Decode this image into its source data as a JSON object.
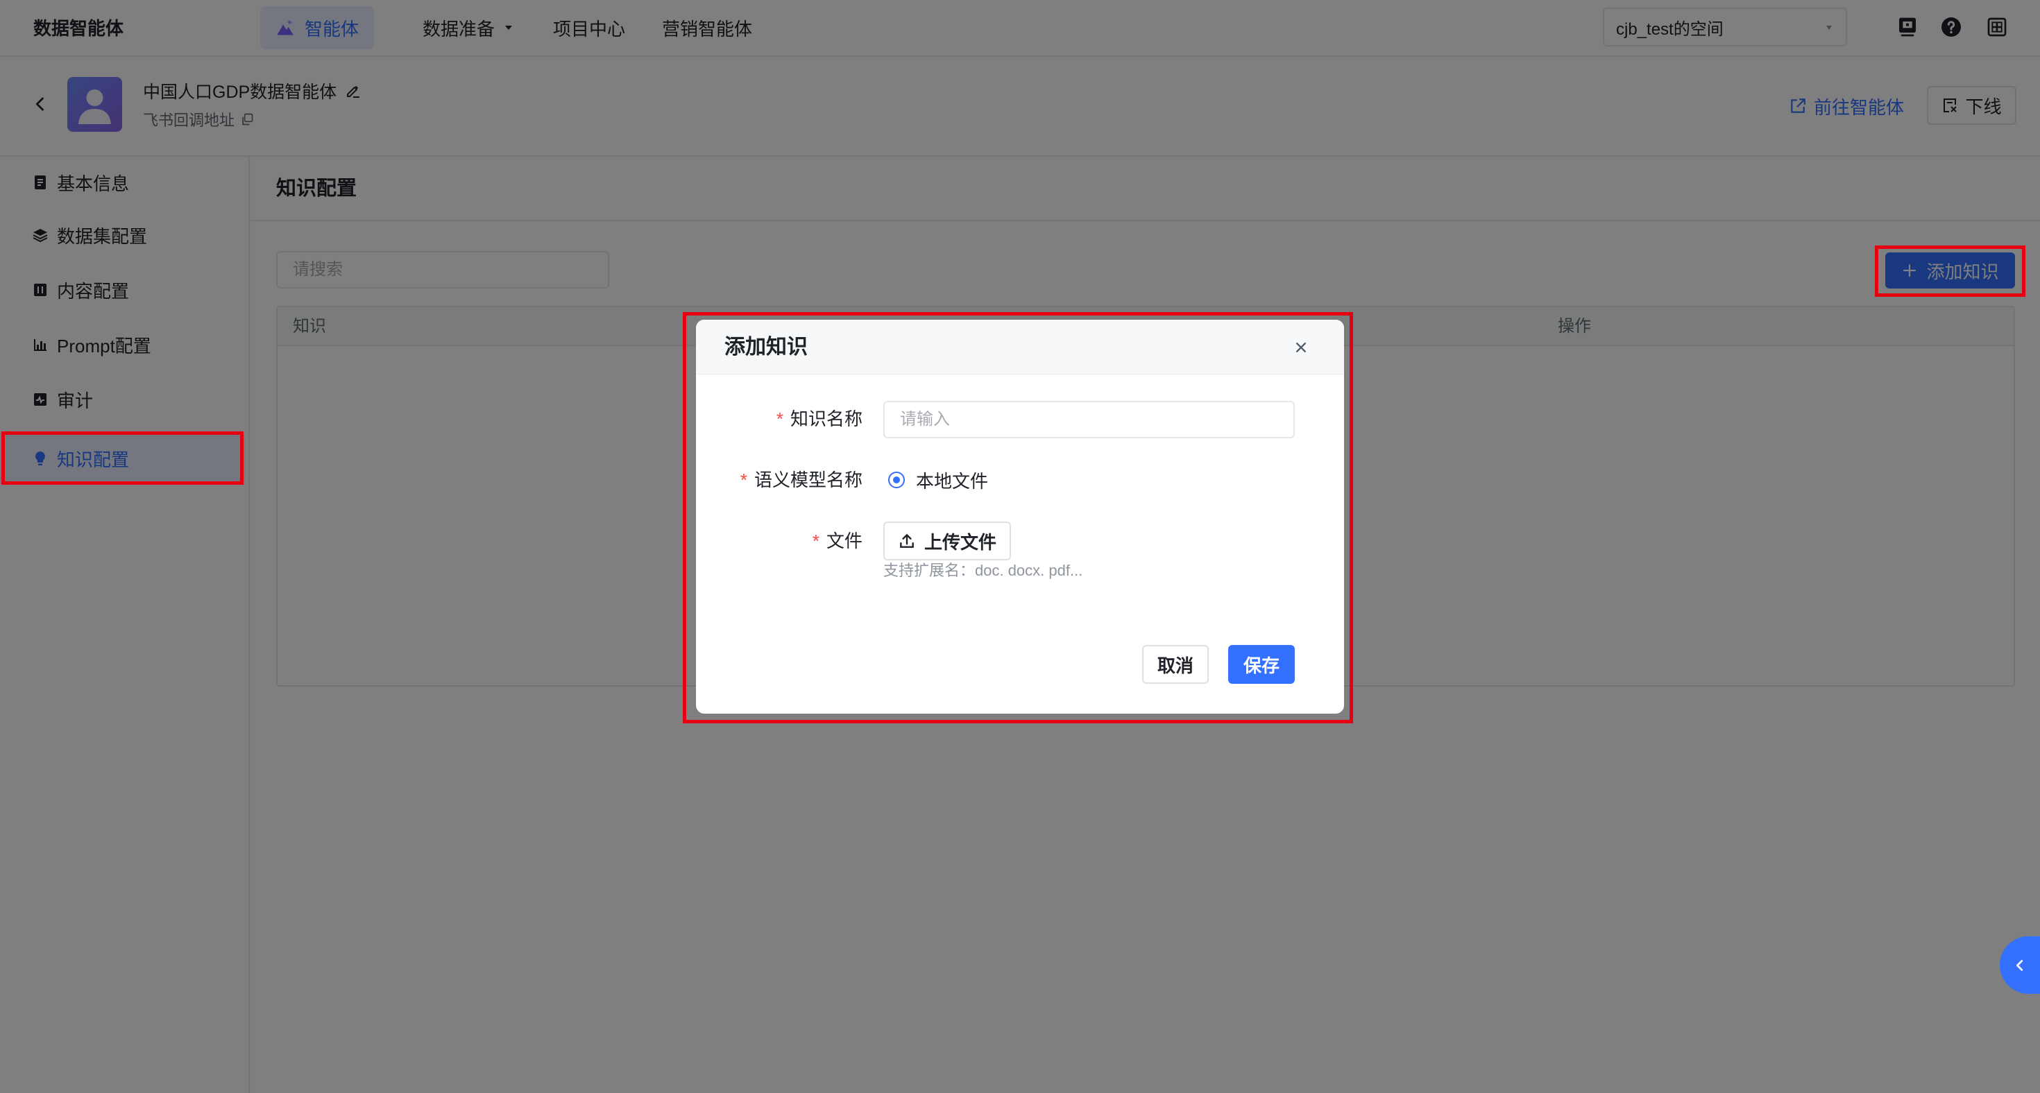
{
  "topnav": {
    "brand": "数据智能体",
    "items": [
      {
        "label": "智能体",
        "icon": "agent-icon",
        "active": true
      },
      {
        "label": "数据准备",
        "has_dropdown": true
      },
      {
        "label": "项目中心"
      },
      {
        "label": "营销智能体"
      }
    ],
    "workspace": {
      "selected": "cjb_test的空间"
    },
    "actions": [
      {
        "icon": "monitor-icon"
      },
      {
        "icon": "help-icon"
      },
      {
        "icon": "grid-icon"
      }
    ]
  },
  "agent_header": {
    "title": "中国人口GDP数据智能体",
    "subtitle": "飞书回调地址",
    "goto_label": "前往智能体",
    "offline_label": "下线"
  },
  "sidebar": {
    "items": [
      {
        "label": "基本信息",
        "icon": "file-icon"
      },
      {
        "label": "数据集配置",
        "icon": "layers-icon"
      },
      {
        "label": "内容配置",
        "icon": "table-icon"
      },
      {
        "label": "Prompt配置",
        "icon": "bar-chart-icon"
      },
      {
        "label": "审计",
        "icon": "activity-icon"
      },
      {
        "label": "知识配置",
        "icon": "bulb-icon",
        "active": true
      }
    ]
  },
  "main": {
    "title": "知识配置",
    "search": {
      "placeholder": "请搜索"
    },
    "add_button_label": "添加知识",
    "table": {
      "columns": [
        "知识",
        "操作"
      ],
      "rows": []
    }
  },
  "modal": {
    "title": "添加知识",
    "required_mark": "*",
    "fields": {
      "name": {
        "label": "知识名称",
        "placeholder": "请输入"
      },
      "model": {
        "label": "语义模型名称",
        "options": [
          "本地文件"
        ],
        "selected_index": 0
      },
      "file": {
        "label": "文件",
        "upload_label": "上传文件",
        "hint": "支持扩展名：doc. docx. pdf..."
      }
    },
    "cancel_label": "取消",
    "save_label": "保存"
  },
  "colors": {
    "primary": "#3370ff",
    "active_bg": "#e8efff",
    "required": "#f54a45",
    "annotation": "#e60012",
    "overlay": "rgba(0,0,0,0.5)"
  }
}
